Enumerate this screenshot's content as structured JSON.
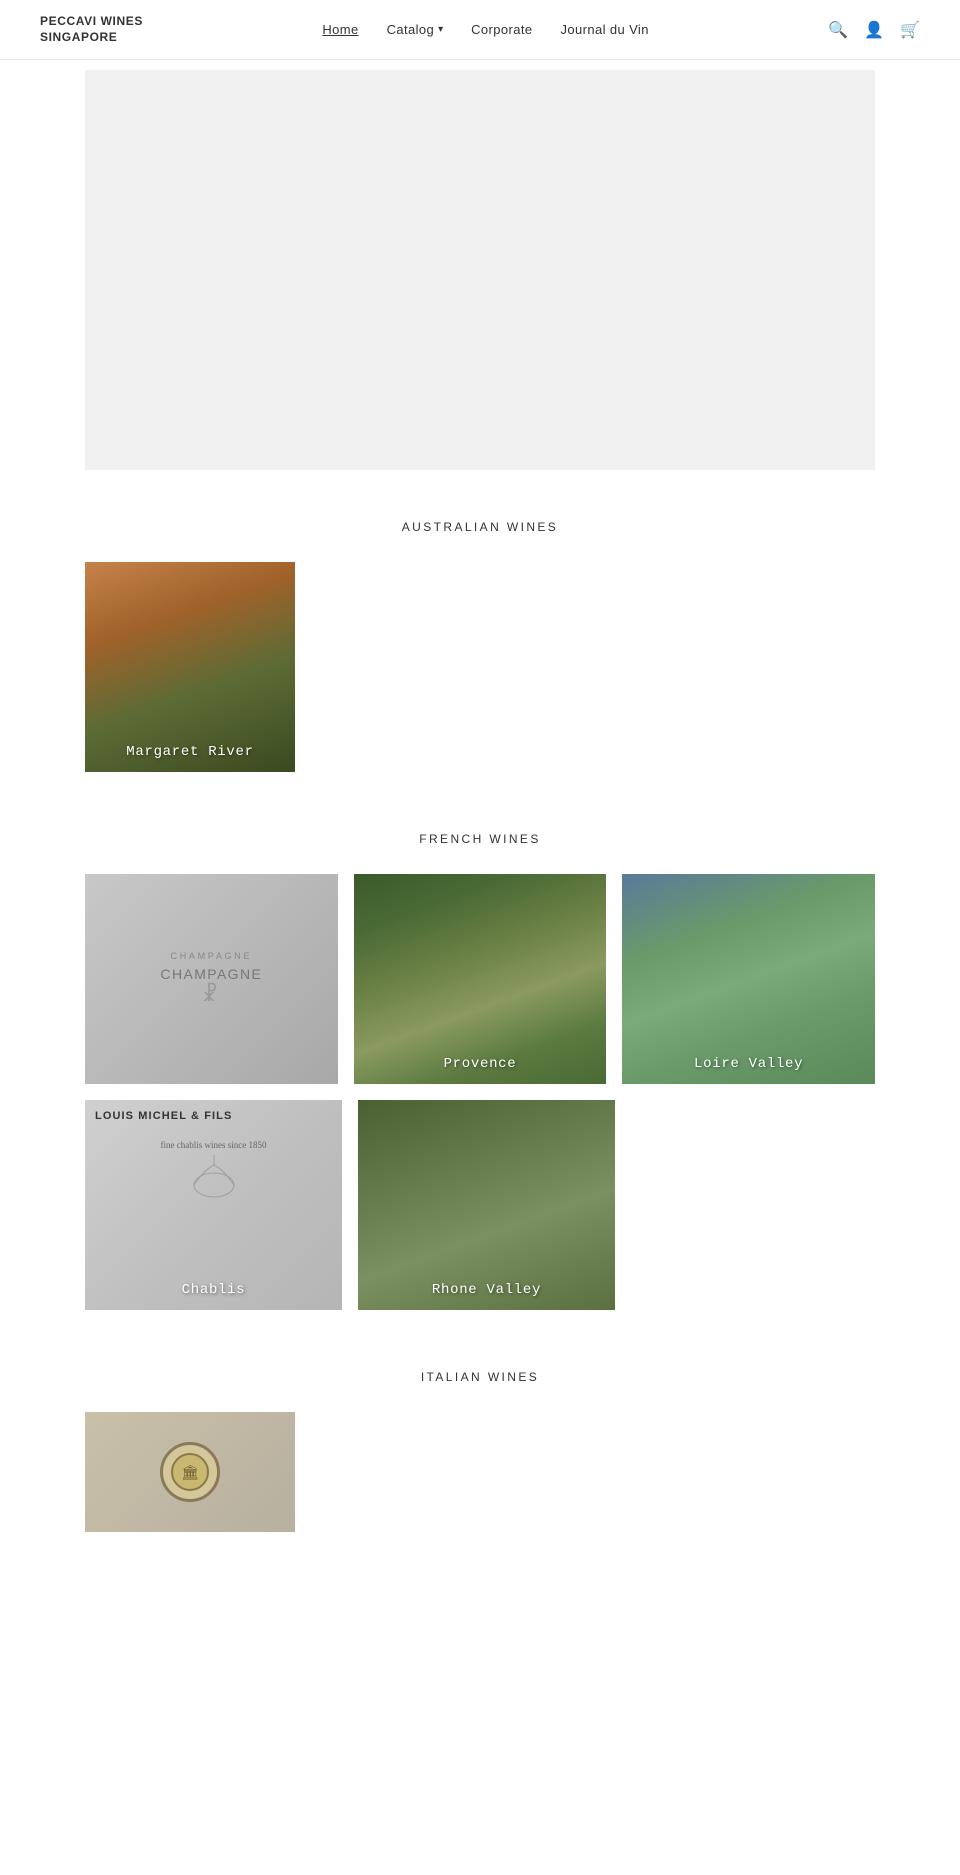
{
  "header": {
    "brand_line1": "PECCAVI WINES",
    "brand_line2": "SINGAPORE",
    "nav": {
      "home": "Home",
      "catalog": "Catalog",
      "corporate": "Corporate",
      "journal": "Journal du Vin"
    }
  },
  "sections": {
    "australian": {
      "title": "AUSTRALIAN WINES",
      "cards": [
        {
          "label": "Margaret River",
          "style": "margaret-river"
        }
      ]
    },
    "french": {
      "title": "FRENCH WINES",
      "row1": [
        {
          "label": "Champagne",
          "style": "champagne"
        },
        {
          "label": "Provence",
          "style": "provence"
        },
        {
          "label": "Loire Valley",
          "style": "loire"
        }
      ],
      "row2": [
        {
          "label": "Chablis",
          "style": "chablis"
        },
        {
          "label": "Rhone Valley",
          "style": "rhone"
        }
      ]
    },
    "italian": {
      "title": "ITALIAN WINES"
    }
  }
}
